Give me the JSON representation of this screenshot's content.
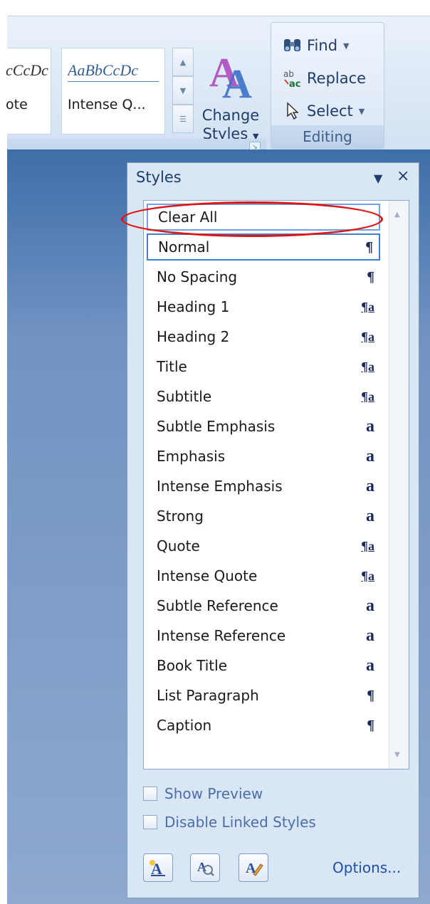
{
  "ribbon": {
    "gallery": [
      {
        "sample": "cCcDc",
        "label": "ote"
      },
      {
        "sample": "AaBbCcDc",
        "label": "Intense Q..."
      }
    ],
    "change_styles": {
      "line1": "Change",
      "line2": "Styles"
    },
    "editing": {
      "find": "Find",
      "replace": "Replace",
      "select": "Select",
      "group_label": "Editing"
    }
  },
  "pane": {
    "title": "Styles",
    "styles": [
      {
        "name": "Clear All",
        "glyph": ""
      },
      {
        "name": "Normal",
        "glyph": "¶"
      },
      {
        "name": "No Spacing",
        "glyph": "¶"
      },
      {
        "name": "Heading 1",
        "glyph": "¶a"
      },
      {
        "name": "Heading 2",
        "glyph": "¶a"
      },
      {
        "name": "Title",
        "glyph": "¶a"
      },
      {
        "name": "Subtitle",
        "glyph": "¶a"
      },
      {
        "name": "Subtle Emphasis",
        "glyph": "a"
      },
      {
        "name": "Emphasis",
        "glyph": "a"
      },
      {
        "name": "Intense Emphasis",
        "glyph": "a"
      },
      {
        "name": "Strong",
        "glyph": "a"
      },
      {
        "name": "Quote",
        "glyph": "¶a"
      },
      {
        "name": "Intense Quote",
        "glyph": "¶a"
      },
      {
        "name": "Subtle Reference",
        "glyph": "a"
      },
      {
        "name": "Intense Reference",
        "glyph": "a"
      },
      {
        "name": "Book Title",
        "glyph": "a"
      },
      {
        "name": "List Paragraph",
        "glyph": "¶"
      },
      {
        "name": "Caption",
        "glyph": "¶"
      }
    ],
    "show_preview": "Show Preview",
    "disable_linked": "Disable Linked Styles",
    "options": "Options..."
  },
  "colors": {
    "highlight": "#e11414",
    "pane_bg": "#d9e6f5",
    "accent": "#1f4fa8"
  }
}
